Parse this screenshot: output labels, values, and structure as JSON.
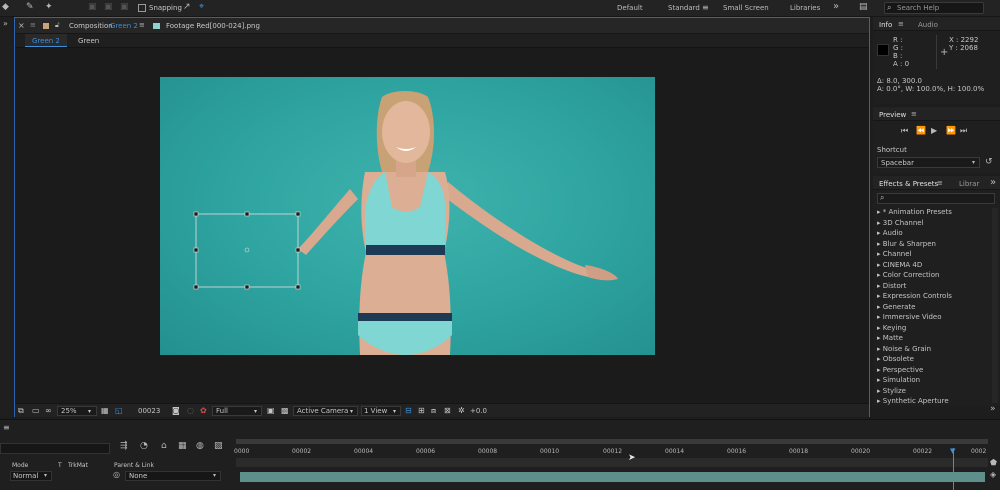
{
  "toolbar": {
    "snapping_label": "Snapping",
    "workspaces": [
      "Default",
      "Standard",
      "Small Screen",
      "Libraries"
    ],
    "active_workspace": "Standard",
    "search_placeholder": "Search Help"
  },
  "comp_panel": {
    "tab_prefix": "Composition",
    "tab_name": "Green 2",
    "footage_tab": "Footage  Red[000-024].png",
    "breadcrumb": [
      "Green 2",
      "Green"
    ]
  },
  "comp_bottom": {
    "zoom": "25%",
    "timecode": "00023",
    "resolution": "Full",
    "camera": "Active Camera",
    "views": "1 View",
    "exposure": "+0.0"
  },
  "info_panel": {
    "tab_info": "Info",
    "tab_audio": "Audio",
    "r": "R :",
    "g": "G :",
    "b": "B :",
    "a": "A :  0",
    "x": "X : 2292",
    "y": "Y : 2068",
    "line1": "Δ: 8.0, 300.0",
    "line2": "A: 0.0°, W: 100.0%, H: 100.0%"
  },
  "preview_panel": {
    "title": "Preview",
    "shortcut_label": "Shortcut",
    "shortcut_value": "Spacebar"
  },
  "effects_panel": {
    "tab_effects": "Effects & Presets",
    "tab_libraries": "Librar",
    "items": [
      "* Animation Presets",
      "3D Channel",
      "Audio",
      "Blur & Sharpen",
      "Channel",
      "CINEMA 4D",
      "Color Correction",
      "Distort",
      "Expression Controls",
      "Generate",
      "Immersive Video",
      "Keying",
      "Matte",
      "Noise & Grain",
      "Obsolete",
      "Perspective",
      "Simulation",
      "Stylize",
      "Synthetic Aperture"
    ]
  },
  "timeline": {
    "columns": {
      "mode": "Mode",
      "t": "T",
      "trkmat": "TrkMat",
      "parent": "Parent & Link"
    },
    "layer_mode": "Normal",
    "layer_parent": "None",
    "ticks": [
      "0000",
      "00002",
      "00004",
      "00006",
      "00008",
      "00010",
      "00012",
      "00014",
      "00016",
      "00018",
      "00020",
      "00022",
      "0002"
    ]
  },
  "colors": {
    "accent": "#3d8fd9",
    "footage_bg": "#30a6a2",
    "panel_border": "#2f63b3"
  }
}
